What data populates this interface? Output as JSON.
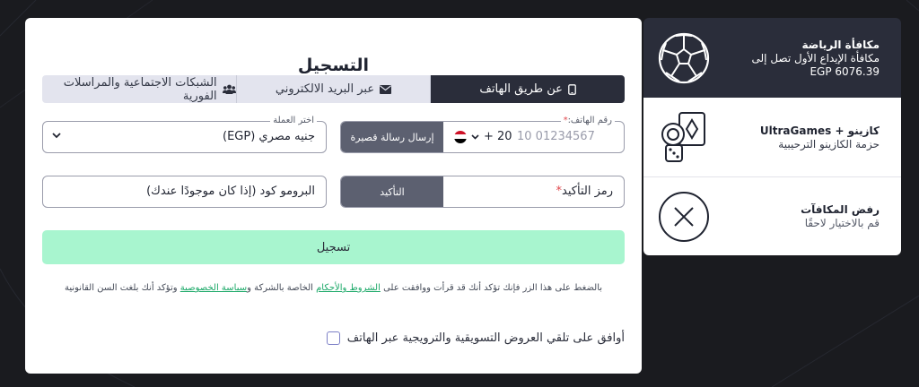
{
  "form": {
    "title": "التسجيل",
    "tabs": [
      {
        "label": "عن طريق الهاتف",
        "icon": "phone-icon",
        "active": true
      },
      {
        "label": "عبر البريد الالكتروني",
        "icon": "envelope-icon",
        "active": false
      },
      {
        "label": "الشبكات الاجتماعية والمراسلات الفورية",
        "icon": "users-icon",
        "active": false
      }
    ],
    "currency": {
      "legend": "اختر العملة",
      "value": "جنيه مصري (EGP)"
    },
    "phone": {
      "legend": "رقم الهاتف:",
      "required_mark": "*",
      "prefix": "+ 20",
      "placeholder": "10 01234567",
      "sms_button": "إرسال رسالة قصيرة"
    },
    "promo": {
      "placeholder": "البرومو كود (إذا كان موجودًا عندك)"
    },
    "confirmation": {
      "placeholder": "رمز التأكيد",
      "required_mark": "*",
      "button": "التأكيد"
    },
    "register_button": "تسجيل",
    "legal": {
      "part1": "بالضغط على هذا الزر فإنك تؤكد أنك قد قرأت ووافقت على ",
      "terms_link": "الشروط والأحكام",
      "part2": " الخاصة بالشركة و",
      "privacy_link": "سياسة الخصوصية",
      "part3": " وتؤكد أنك بلغت السن القانونية"
    },
    "consent_label": "أوافق على تلقي العروض التسويقية والترويجية عبر الهاتف"
  },
  "bonuses": [
    {
      "title": "مكافأة الرياضة",
      "line1": "مكافأة الإيداع الأول تصل إلى",
      "line2": "EGP 6076.39",
      "icon": "soccer-ball-icon",
      "selected": true
    },
    {
      "title": "كازينو + UltraGames",
      "line1": "حزمة الكازينو الترحيبية",
      "icon": "casino-icon",
      "selected": false
    },
    {
      "title": "رفض المكافآت",
      "line1": "قم بالاختيار لاحقًا",
      "icon": "close-circle-icon",
      "selected": false
    }
  ],
  "colors": {
    "background": "#1a1b1f",
    "accent_green": "#a8f5cf",
    "link_green": "#1aa867",
    "dark_panel": "#2a2d3a",
    "required_red": "#e0474c"
  }
}
